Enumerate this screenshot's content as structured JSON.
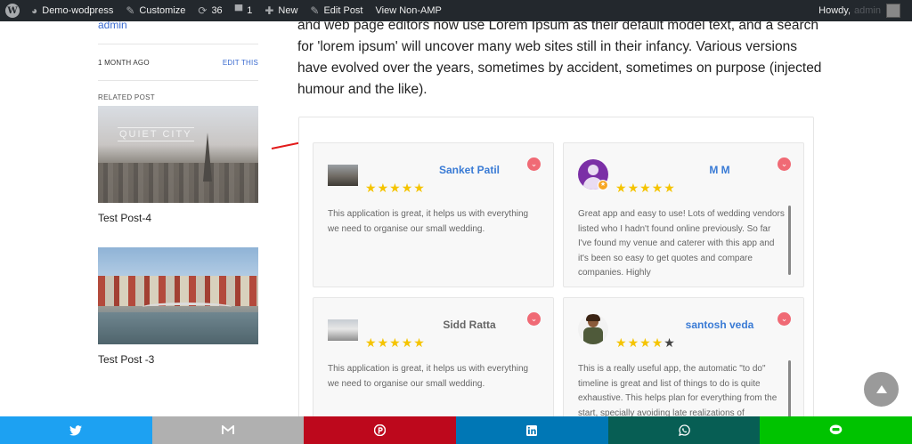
{
  "adminbar": {
    "site_name": "Demo-wodpress",
    "customize": "Customize",
    "updates_count": "36",
    "comments_count": "1",
    "new": "New",
    "edit_post": "Edit Post",
    "view_non_amp": "View Non-AMP",
    "howdy": "Howdy,",
    "username": "admin"
  },
  "sidebar": {
    "author": "admin",
    "date": "1 MONTH AGO",
    "edit_link": "EDIT THIS",
    "related_heading": "RELATED POST",
    "posts": [
      {
        "title": "Test Post-4",
        "thumb_caption": "QUIET CITY"
      },
      {
        "title": "Test Post -3"
      }
    ]
  },
  "article": {
    "text": "and web page editors now use Lorem Ipsum as their default model text, and a search for 'lorem ipsum' will uncover many web sites still in their infancy. Various versions have evolved over the years, sometimes by accident, sometimes on purpose (injected humour and the like)."
  },
  "reviews": [
    {
      "name": "Sanket Patil",
      "rating": 5,
      "text": "This application is great, it helps us with everything we need to organise our small wedding."
    },
    {
      "name": "M M",
      "rating": 5,
      "text": "Great app and easy to use! Lots of wedding vendors listed who I hadn't found online previously. So far I've found my venue and caterer with this app and it's been so easy to get quotes and compare companies. Highly"
    },
    {
      "name": "Sidd Ratta",
      "rating": 5,
      "text": "This application is great, it helps us with everything we need to organise our small wedding."
    },
    {
      "name": "santosh veda",
      "rating": 4,
      "text": "This is a really useful app, the automatic \"to do\" timeline is great and list of things to do is quite exhaustive. This helps plan for everything from the start, specially avoiding late realizations of"
    }
  ],
  "share_buttons": [
    {
      "network": "twitter",
      "icon": "twitter-icon",
      "color": "#1da1f2"
    },
    {
      "network": "gmail",
      "icon": "gmail-icon",
      "color": "#b0b0b0"
    },
    {
      "network": "pinterest",
      "icon": "pinterest-icon",
      "color": "#bd081c"
    },
    {
      "network": "linkedin",
      "icon": "linkedin-icon",
      "color": "#0077b5"
    },
    {
      "network": "whatsapp",
      "icon": "whatsapp-icon",
      "color": "#075e54"
    },
    {
      "network": "line",
      "icon": "line-icon",
      "color": "#00c300"
    }
  ],
  "colors": {
    "link": "#3a7bd5",
    "star": "#f5c400",
    "badge": "#f06a75",
    "adminbar": "#23282d"
  }
}
